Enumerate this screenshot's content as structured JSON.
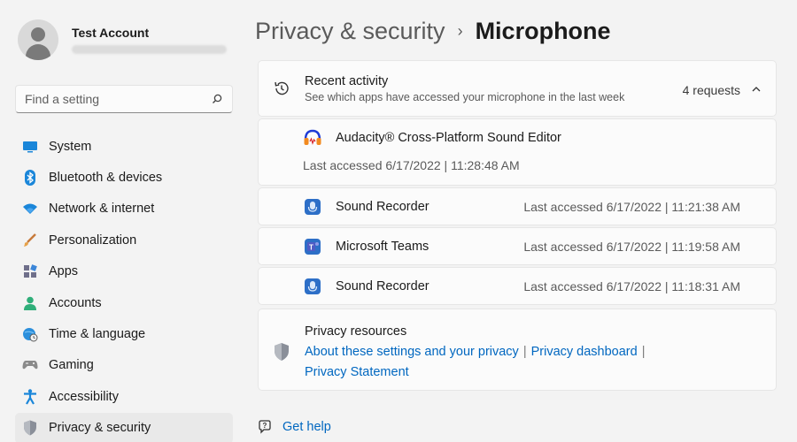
{
  "profile": {
    "name": "Test Account"
  },
  "search": {
    "placeholder": "Find a setting"
  },
  "sidebar": {
    "items": [
      {
        "label": "System",
        "icon": "monitor-icon"
      },
      {
        "label": "Bluetooth & devices",
        "icon": "bluetooth-icon"
      },
      {
        "label": "Network & internet",
        "icon": "wifi-icon"
      },
      {
        "label": "Personalization",
        "icon": "brush-icon"
      },
      {
        "label": "Apps",
        "icon": "apps-icon"
      },
      {
        "label": "Accounts",
        "icon": "person-icon"
      },
      {
        "label": "Time & language",
        "icon": "globe-clock-icon"
      },
      {
        "label": "Gaming",
        "icon": "gamepad-icon"
      },
      {
        "label": "Accessibility",
        "icon": "accessibility-icon"
      },
      {
        "label": "Privacy & security",
        "icon": "shield-icon",
        "active": true
      }
    ]
  },
  "header": {
    "parent": "Privacy & security",
    "separator": "›",
    "current": "Microphone"
  },
  "recent": {
    "title": "Recent activity",
    "description": "See which apps have accessed your microphone in the last week",
    "count": "4 requests",
    "entries": [
      {
        "app": "Audacity® Cross-Platform Sound Editor",
        "accessed": "Last accessed 6/17/2022 | 11:28:48 AM",
        "icon": "headphones-icon"
      },
      {
        "app": "Sound Recorder",
        "accessed": "Last accessed 6/17/2022 | 11:21:38 AM",
        "icon": "sound-recorder-icon"
      },
      {
        "app": "Microsoft Teams",
        "accessed": "Last accessed 6/17/2022 | 11:19:58 AM",
        "icon": "teams-icon"
      },
      {
        "app": "Sound Recorder",
        "accessed": "Last accessed 6/17/2022 | 11:18:31 AM",
        "icon": "sound-recorder-icon"
      }
    ]
  },
  "resources": {
    "title": "Privacy resources",
    "link1": "About these settings and your privacy",
    "link2": "Privacy dashboard",
    "link3": "Privacy Statement",
    "separator": "|"
  },
  "help": {
    "label": "Get help"
  },
  "colors": {
    "accent": "#0067c0",
    "background": "#f3f3f3",
    "card": "#fbfbfb"
  }
}
